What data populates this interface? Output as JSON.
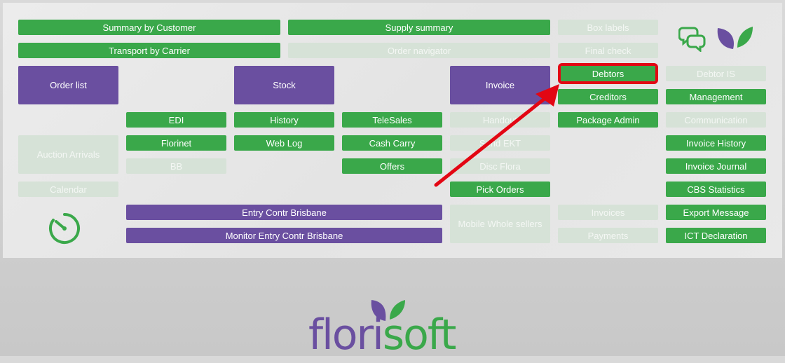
{
  "colors": {
    "green": "#3aa84a",
    "purple": "#6a4fa0",
    "disabled": "#d6e2d7",
    "highlight": "#e30613"
  },
  "buttons": {
    "summary_by_customer": "Summary by Customer",
    "supply_summary": "Supply summary",
    "box_labels": "Box labels",
    "transport_by_carrier": "Transport by Carrier",
    "order_navigator": "Order navigator",
    "final_check": "Final check",
    "order_list": "Order list",
    "stock": "Stock",
    "invoice": "Invoice",
    "debtors": "Debtors",
    "debtor_is": "Debtor IS",
    "creditors": "Creditors",
    "management": "Management",
    "edi": "EDI",
    "history": "History",
    "telesales": "TeleSales",
    "handout": "Handout",
    "package_admin": "Package Admin",
    "communication": "Communication",
    "florinet": "Florinet",
    "web_log": "Web Log",
    "cash_carry": "Cash Carry",
    "send_ekt": "Send EKT",
    "invoice_history": "Invoice History",
    "auction_arrivals": "Auction Arrivals",
    "bb": "BB",
    "offers": "Offers",
    "disc_flora": "Disc Flora",
    "invoice_journal": "Invoice Journal",
    "calendar": "Calendar",
    "pick_orders": "Pick Orders",
    "cbs_statistics": "CBS Statistics",
    "entry_contr_brisbane": "Entry Contr Brisbane",
    "mobile_whole_sellers": "Mobile Whole sellers",
    "invoices": "Invoices",
    "export_message": "Export Message",
    "monitor_entry_contr_brisbane": "Monitor Entry Contr Brisbane",
    "payments": "Payments",
    "ict_declaration": "ICT Declaration"
  },
  "icons": {
    "chat": "chat-icon",
    "leaf": "leaf-logo-icon",
    "timer": "stopwatch-icon"
  },
  "logo": {
    "part1": "flor",
    "part2": "soft",
    "i": "i"
  }
}
